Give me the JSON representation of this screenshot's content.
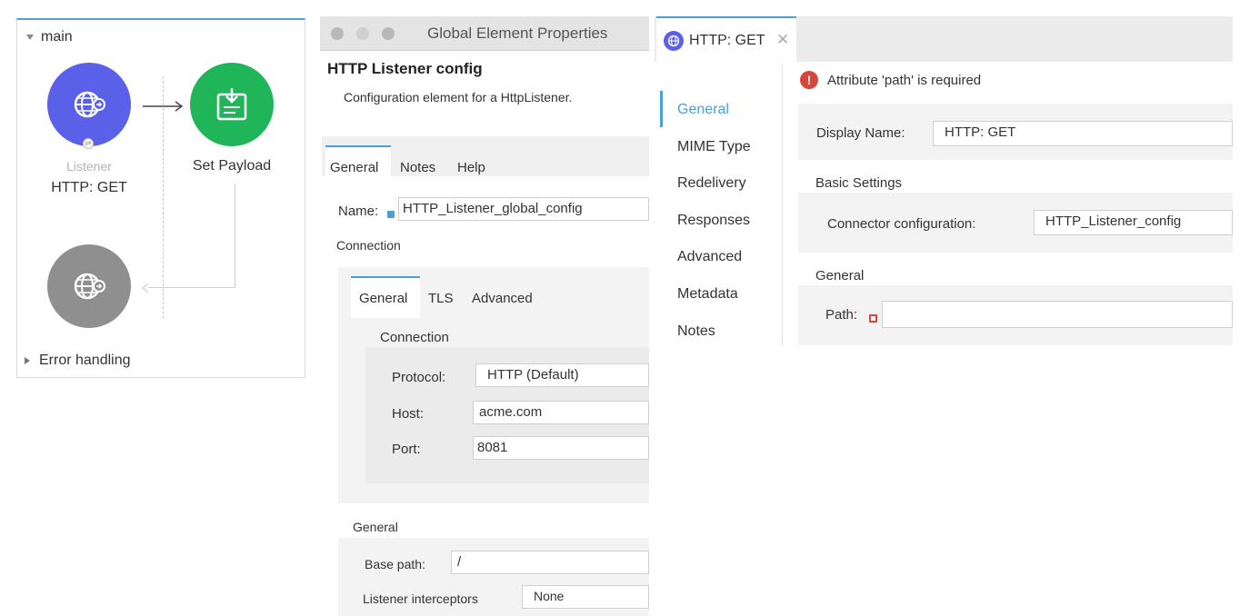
{
  "flow": {
    "main_label": "main",
    "listener_sub": "Listener",
    "listener_name": "HTTP: GET",
    "set_payload": "Set Payload",
    "error_handling": "Error handling",
    "colors": {
      "listener": "#5b60e8",
      "payload": "#21b55a",
      "response": "#8f8f8f"
    }
  },
  "gep": {
    "window_title": "Global Element Properties",
    "heading": "HTTP Listener config",
    "description": "Configuration element for a HttpListener.",
    "tabs": [
      "General",
      "Notes",
      "Help"
    ],
    "name_label": "Name:",
    "name_value": "HTTP_Listener_global_config",
    "connection_section": "Connection",
    "inner_tabs": [
      "General",
      "TLS",
      "Advanced"
    ],
    "inner_connection": "Connection",
    "protocol_label": "Protocol:",
    "protocol_value": "HTTP (Default)",
    "host_label": "Host:",
    "host_value": "acme.com",
    "port_label": "Port:",
    "port_value": "8081",
    "general_section": "General",
    "base_path_label": "Base path:",
    "base_path_value": "/",
    "interceptors_label": "Listener interceptors",
    "interceptors_value": "None"
  },
  "editor": {
    "tab_title": "HTTP: GET",
    "error_message": "Attribute 'path' is required",
    "side_items": [
      "General",
      "MIME Type",
      "Redelivery",
      "Responses",
      "Advanced",
      "Metadata",
      "Notes"
    ],
    "display_name_label": "Display Name:",
    "display_name_value": "HTTP: GET",
    "basic_settings": "Basic Settings",
    "connector_label": "Connector configuration:",
    "connector_value": "HTTP_Listener_config",
    "general_section": "General",
    "path_label": "Path:",
    "path_value": "",
    "accent": "#4a9fd8",
    "error_color": "#d9453b"
  }
}
